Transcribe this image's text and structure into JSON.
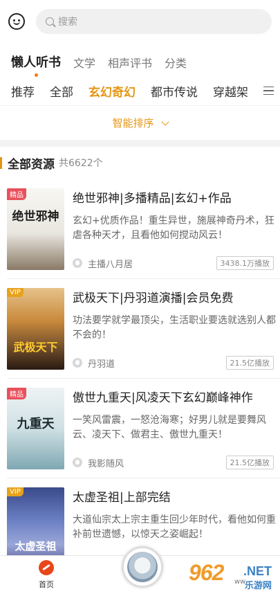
{
  "header": {
    "search_placeholder": "搜索"
  },
  "categories": [
    "懒人听书",
    "文学",
    "相声评书",
    "分类"
  ],
  "subnav": [
    "推荐",
    "全部",
    "玄幻奇幻",
    "都市传说",
    "穿越架"
  ],
  "sort": {
    "label": "智能排序"
  },
  "section": {
    "title": "全部资源",
    "count": "共6622个"
  },
  "items": [
    {
      "tag": "精品",
      "tag_color": "#e8505b",
      "cover_text": "绝世邪神",
      "title": "绝世邪神|多播精品|玄幻+作品",
      "desc": "玄幻+优质作品！重生异世，施展神奇丹术，狂虐各种天才，且看他如何搅动风云！",
      "host": "主播八月居",
      "plays": "3438.1万播放"
    },
    {
      "tag": "VIP",
      "tag_color": "#e8a21a",
      "cover_text": "武极天下",
      "title": "武极天下|丹羽道演播|会员免费",
      "desc": "功法要学就学最顶尖，生活职业要选就选别人都不会的！",
      "host": "丹羽道",
      "plays": "21.5亿播放"
    },
    {
      "tag": "精品",
      "tag_color": "#e8505b",
      "cover_text": "九重天",
      "title": "傲世九重天|风凌天下玄幻巅峰神作",
      "desc": "一笑风雷震，一怒沧海寒；好男儿就是要舞风云、凌天下、做君主、傲世九重天！",
      "host": "我影随风",
      "plays": "21.5亿播放"
    },
    {
      "tag": "VIP",
      "tag_color": "#e8a21a",
      "cover_text": "太虚圣祖",
      "title": "太虚圣祖|上部完结",
      "desc": "大道仙宗太上宗主重生回少年时代，看他如何重补前世遗憾，以惊天之姿崛起！",
      "host": "",
      "plays": ""
    }
  ],
  "tabbar": {
    "home_label": "首页"
  },
  "watermark": {
    "big": "962",
    "net": ".NET",
    "cn": "乐游网",
    "cn2": "ww"
  }
}
